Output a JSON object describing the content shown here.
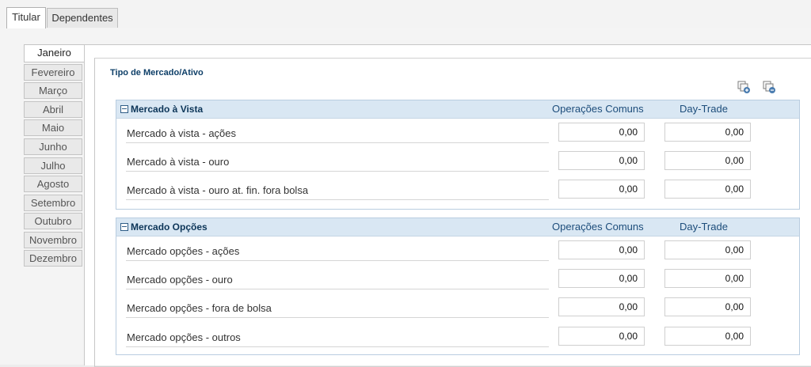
{
  "top_tabs": [
    "Titular",
    "Dependentes"
  ],
  "months": [
    "Janeiro",
    "Fevereiro",
    "Março",
    "Abril",
    "Maio",
    "Junho",
    "Julho",
    "Agosto",
    "Setembro",
    "Outubro",
    "Novembro",
    "Dezembro"
  ],
  "fieldset_title": "Tipo de Mercado/Ativo",
  "toolbar": {
    "expand_icon": "expand-all-icon",
    "collapse_icon": "collapse-all-icon"
  },
  "columns": {
    "common": "Operações Comuns",
    "day_trade": "Day-Trade"
  },
  "sections": [
    {
      "title": "Mercado à Vista",
      "rows": [
        {
          "label": "Mercado à vista - ações",
          "common": "0,00",
          "day_trade": "0,00"
        },
        {
          "label": "Mercado à vista - ouro",
          "common": "0,00",
          "day_trade": "0,00"
        },
        {
          "label": "Mercado à vista - ouro at. fin. fora bolsa",
          "common": "0,00",
          "day_trade": "0,00"
        }
      ]
    },
    {
      "title": "Mercado Opções",
      "rows": [
        {
          "label": "Mercado opções - ações",
          "common": "0,00",
          "day_trade": "0,00"
        },
        {
          "label": "Mercado opções - ouro",
          "common": "0,00",
          "day_trade": "0,00"
        },
        {
          "label": "Mercado opções - fora de bolsa",
          "common": "0,00",
          "day_trade": "0,00"
        },
        {
          "label": "Mercado opções - outros",
          "common": "0,00",
          "day_trade": "0,00"
        }
      ]
    }
  ]
}
